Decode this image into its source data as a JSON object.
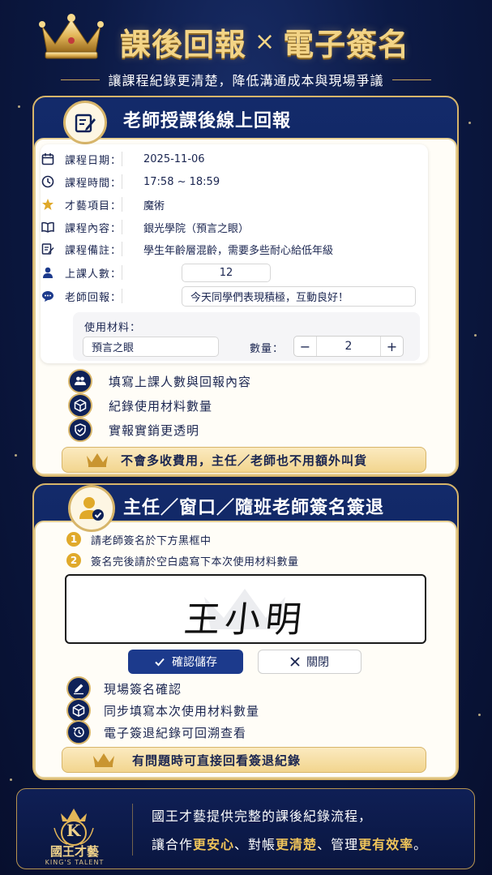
{
  "header": {
    "title_left": "課後回報",
    "title_sep": "×",
    "title_right": "電子簽名",
    "subtitle": "讓課程紀錄更清楚，降低溝通成本與現場爭議"
  },
  "section1": {
    "title": "老師授課後線上回報",
    "form": {
      "date": {
        "label": "課程日期：",
        "value": "2025-11-06"
      },
      "time": {
        "label": "課程時間：",
        "value": "17:58 ~ 18:59"
      },
      "item": {
        "label": "才藝項目：",
        "value": "魔術"
      },
      "content": {
        "label": "課程內容：",
        "value": "銀光學院（預言之眼）"
      },
      "remark": {
        "label": "課程備註：",
        "value": "學生年齡層混齡，需要多些耐心給低年級"
      },
      "people": {
        "label": "上課人數：",
        "value": "12"
      },
      "reply": {
        "label": "老師回報：",
        "value": "今天同學們表現積極，互動良好！"
      },
      "materials_label": "使用材料：",
      "material_name": "預言之眼",
      "qty_label": "數量：",
      "qty_value": "2",
      "minus": "−",
      "plus": "+"
    },
    "features": [
      {
        "text": "填寫上課人數與回報內容",
        "icon": "people-icon"
      },
      {
        "text": "紀錄使用材料數量",
        "icon": "box-icon"
      },
      {
        "text": "實報實銷更透明",
        "icon": "shield-check-icon"
      }
    ],
    "note": "不會多收費用，主任／老師也不用額外叫貨"
  },
  "section2": {
    "title": "主任／窗口／隨班老師簽名簽退",
    "steps": [
      {
        "num": "1",
        "text": "請老師簽名於下方黑框中"
      },
      {
        "num": "2",
        "text": "簽名完後請於空白處寫下本次使用材料數量"
      }
    ],
    "signature": "王小明",
    "confirm_label": "確認儲存",
    "close_label": "關閉",
    "features": [
      {
        "text": "現場簽名確認",
        "icon": "pen-icon"
      },
      {
        "text": "同步填寫本次使用材料數量",
        "icon": "box-icon"
      },
      {
        "text": "電子簽退紀錄可回溯查看",
        "icon": "history-icon"
      }
    ],
    "note": "有問題時可直接回看簽退紀錄"
  },
  "footer": {
    "logo_letter": "K",
    "logo_name": "國王才藝",
    "logo_en": "KING'S TALENT",
    "line1": "國王才藝提供完整的課後紀錄流程，",
    "line2_a": "讓合作",
    "line2_b": "更安心",
    "line2_c": "、對帳",
    "line2_d": "更清楚",
    "line2_e": "、管理",
    "line2_f": "更有效率",
    "line2_g": "。"
  },
  "colors": {
    "gold": "#d7b56a",
    "navy": "#0d1f55",
    "accent": "#f0c45a"
  }
}
